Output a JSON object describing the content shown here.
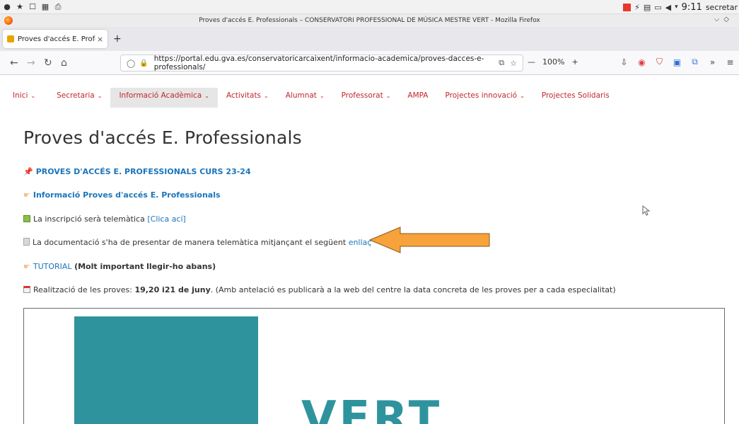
{
  "os": {
    "clock": "9:11",
    "user": "secretar"
  },
  "window": {
    "title": "Proves d'accés E. Professionals – CONSERVATORI PROFESSIONAL DE MÚSICA MESTRE VERT - Mozilla Firefox"
  },
  "tabs": [
    {
      "label": "Proves d'accés E. Professio"
    }
  ],
  "nav": {
    "url": "https://portal.edu.gva.es/conservatoricarcaixent/informacio-academica/proves-dacces-e-professionals/",
    "zoom": "100%"
  },
  "menu": [
    {
      "label": "Inici"
    },
    {
      "label": "Secretaria"
    },
    {
      "label": "Informació Acadèmica"
    },
    {
      "label": "Activitats"
    },
    {
      "label": "Alumnat"
    },
    {
      "label": "Professorat"
    },
    {
      "label": "AMPA"
    },
    {
      "label": "Projectes innovació"
    },
    {
      "label": "Projectes Solidaris"
    }
  ],
  "content": {
    "title": "Proves d'accés E. Professionals",
    "heading_link": "PROVES D'ACCÉS E. PROFESSIONALS CURS 23-24",
    "info_link": "Informació Proves d'accés E. Professionals",
    "inscription_text": "La inscripció serà telemàtica ",
    "inscription_link": "[Clica ací]",
    "doc_text": "La documentació s'ha de presentar de manera telemàtica mitjançant el següent ",
    "doc_link": "enllaç",
    "tutorial_link": "TUTORIAL",
    "tutorial_note": "(Molt important llegir-ho abans)",
    "dates_prefix": "Realització de les proves: ",
    "dates_bold": "19,20 i21 de juny",
    "dates_suffix": ". (Amb antelació es publicarà a la web del centre la data concreta de les proves per a cada especialitat)",
    "logo_text": "VERT"
  },
  "colors": {
    "menu_red": "#c1272d",
    "link_blue": "#1b75bb",
    "teal": "#2f939d",
    "arrow_orange": "#f7a23b"
  }
}
